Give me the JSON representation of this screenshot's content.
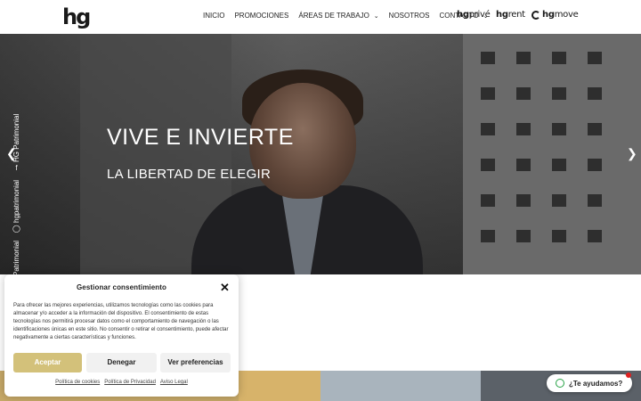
{
  "header": {
    "logo": "hg",
    "nav": [
      {
        "label": "INICIO",
        "has_dropdown": false
      },
      {
        "label": "PROMOCIONES",
        "has_dropdown": false
      },
      {
        "label": "ÁREAS DE TRABAJO",
        "has_dropdown": true
      },
      {
        "label": "NOSOTROS",
        "has_dropdown": false
      },
      {
        "label": "CONTACTO",
        "has_dropdown": true
      }
    ],
    "brands": {
      "prive_prefix": "hg",
      "prive_suffix": "privé",
      "rent_prefix": "hg",
      "rent_suffix": "rent",
      "move_prefix": "hg",
      "move_suffix": "move"
    }
  },
  "hero": {
    "title": "VIVE E INVIERTE",
    "subtitle": "LA LIBERTAD DE ELEGIR",
    "social_facebook": "HG Patrimonial",
    "social_instagram": "hgpatrimonial",
    "social_linkedin": "Patrimonial",
    "icons": {
      "prev": "chevron-left-icon",
      "next": "chevron-right-icon"
    }
  },
  "cookie": {
    "title": "Gestionar consentimiento",
    "text": "Para ofrecer las mejores experiencias, utilizamos tecnologías como las cookies para almacenar y/o acceder a la información del dispositivo. El consentimiento de estas tecnologías nos permitirá procesar datos como el comportamiento de navegación o las identificaciones únicas en este sitio. No consentir o retirar el consentimiento, puede afectar negativamente a ciertas características y funciones.",
    "accept": "Aceptar",
    "deny": "Denegar",
    "prefs": "Ver preferencias",
    "links": [
      "Política de cookies",
      "Política de Privacidad",
      "Aviso Legal"
    ]
  },
  "whatsapp": {
    "label": "¿Te ayudamos?"
  },
  "colors": {
    "accent": "#d3c17a",
    "whatsapp": "#25a244"
  }
}
